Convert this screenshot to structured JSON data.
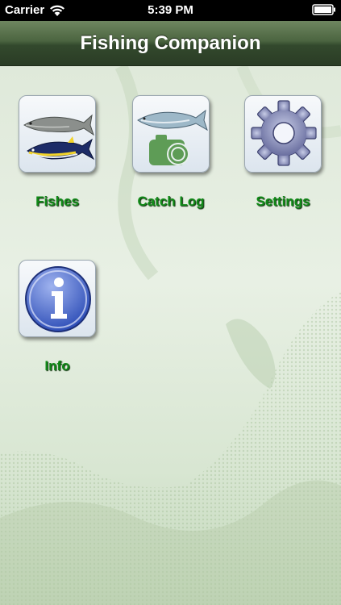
{
  "status_bar": {
    "carrier": "Carrier",
    "time": "5:39 PM",
    "wifi_icon": "wifi-icon",
    "battery_icon": "battery-icon"
  },
  "nav": {
    "title": "Fishing Companion"
  },
  "tiles": [
    {
      "label": "Fishes",
      "icon": "fish-icon"
    },
    {
      "label": "Catch Log",
      "icon": "catch-log-icon"
    },
    {
      "label": "Settings",
      "icon": "gear-icon"
    },
    {
      "label": "Info",
      "icon": "info-icon"
    }
  ],
  "colors": {
    "nav_bar": "#3f5636",
    "label_green": "#118a18",
    "background": "#e6efe2"
  }
}
